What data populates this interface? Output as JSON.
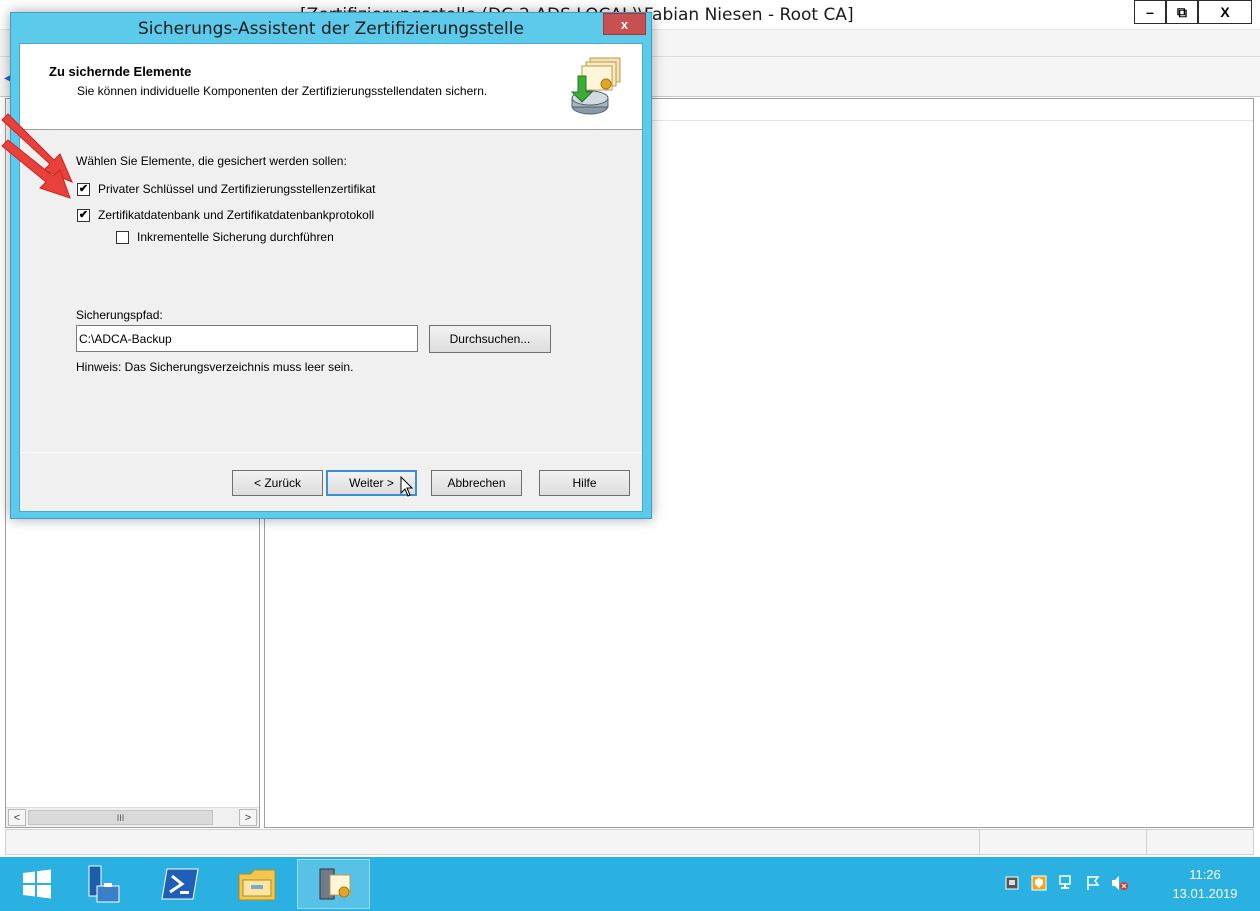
{
  "background_window": {
    "title": "[Zertifizierungsstelle (DC-2.ADS.LOCAL)\\Fabian Niesen - Root CA]",
    "min_label": "–",
    "max_label": "⧉",
    "close_label": "X",
    "scrollbar_thumb": "III",
    "scroll_left": "<",
    "scroll_right": ">"
  },
  "wizard": {
    "title": "Sicherungs-Assistent der Zertifizierungsstelle",
    "close_label": "x",
    "heading": "Zu sichernde Elemente",
    "subheading": "Sie können individuelle Komponenten der Zertifizierungsstellendaten sichern.",
    "select_label": "Wählen Sie Elemente, die gesichert werden sollen:",
    "options": [
      {
        "label": "Privater Schlüssel und Zertifizierungsstellenzertifikat",
        "checked": true
      },
      {
        "label": "Zertifikatdatenbank und Zertifikatdatenbankprotokoll",
        "checked": true
      },
      {
        "label": "Inkrementelle Sicherung durchführen",
        "checked": false
      }
    ],
    "path_label": "Sicherungspfad:",
    "path_value": "C:\\ADCA-Backup",
    "browse_label": "Durchsuchen...",
    "hint": "Hinweis: Das Sicherungsverzeichnis muss leer sein.",
    "buttons": {
      "back": "< Zurück",
      "next": "Weiter >",
      "cancel": "Abbrechen",
      "help": "Hilfe"
    }
  },
  "taskbar": {
    "apps": [
      "start",
      "server-manager",
      "powershell",
      "file-explorer",
      "certification-authority"
    ],
    "tray_icons": [
      "storage-icon",
      "security-shield-icon",
      "network-icon",
      "flag-icon",
      "speaker-muted-icon"
    ],
    "time": "11:26",
    "date": "13.01.2019"
  },
  "colors": {
    "dialog_frame": "#5ccbeb",
    "taskbar": "#2ab0e1",
    "close_button": "#c75050",
    "annotation_arrow": "#e8403a"
  }
}
